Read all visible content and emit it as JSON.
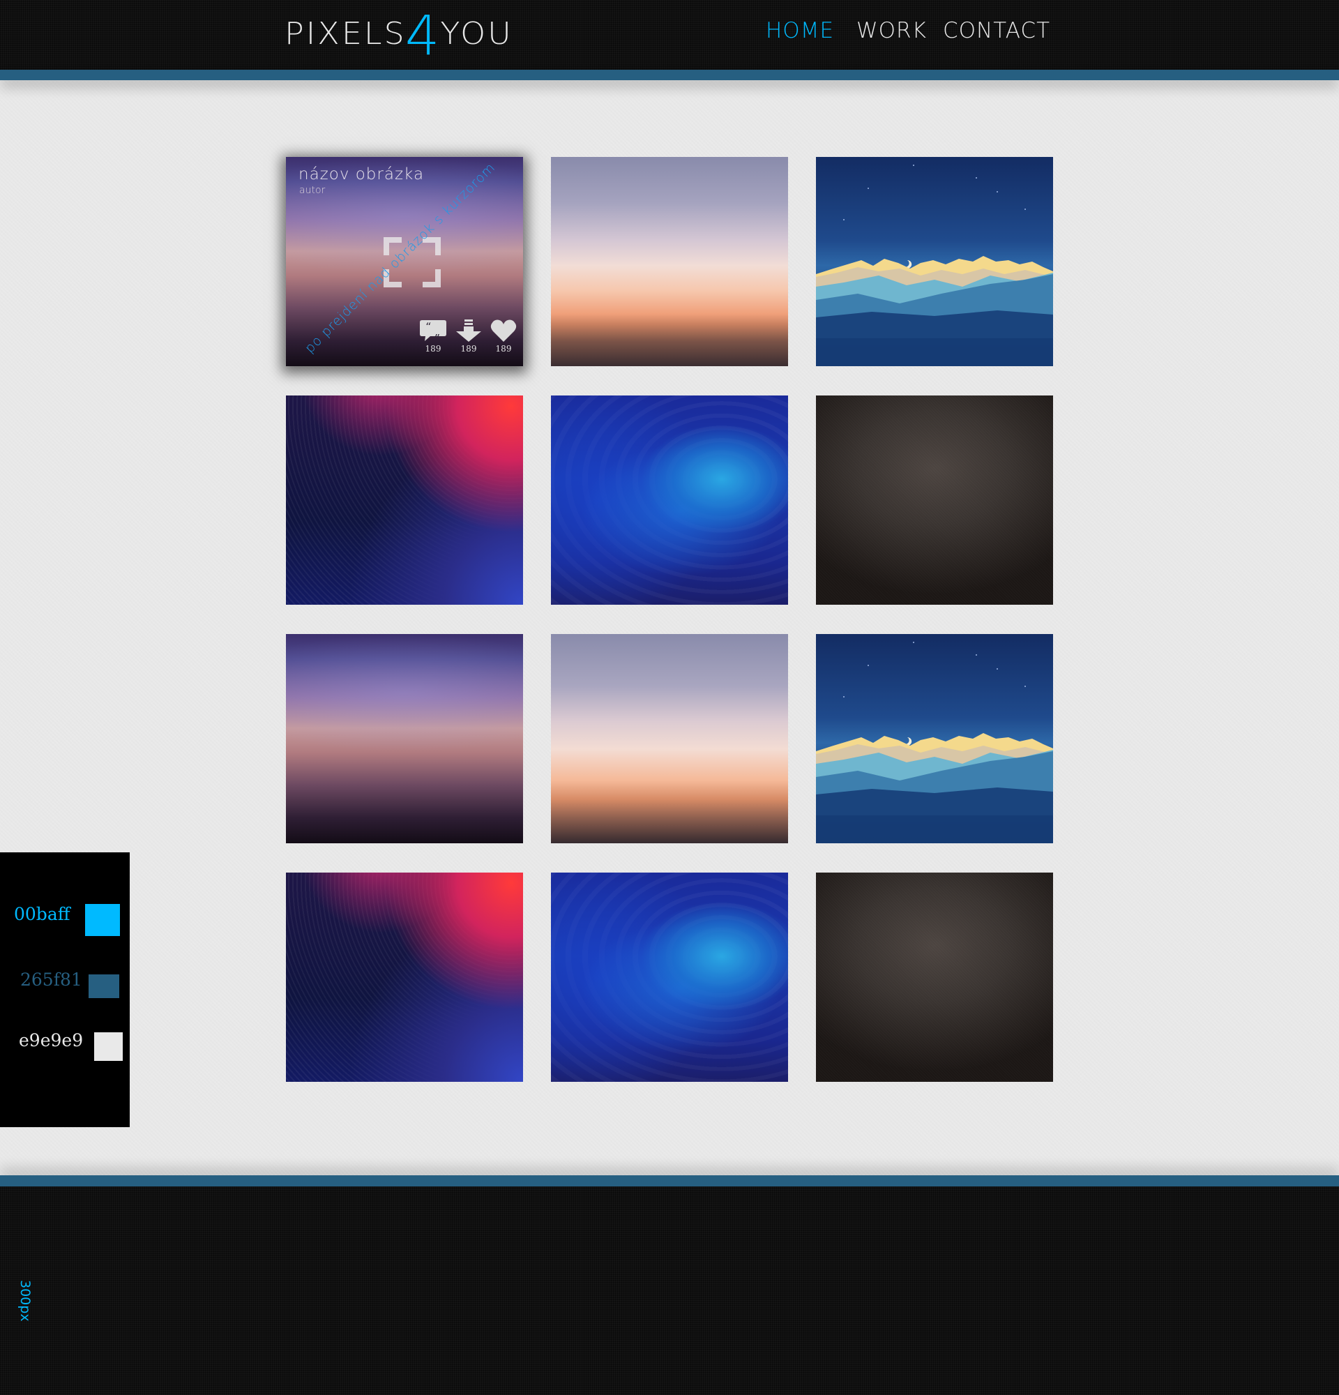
{
  "brand": {
    "logo_left": "PIXELS",
    "logo_digit": "4",
    "logo_right": "YOU",
    "accent_color": "#00baff",
    "stripe_color": "#265f81",
    "background_color": "#e9e9e9"
  },
  "nav": {
    "items": [
      {
        "label": "HOME",
        "active": true
      },
      {
        "label": "WORK",
        "active": false
      },
      {
        "label": "CONTACT",
        "active": false
      }
    ]
  },
  "gallery": {
    "hover_tile": {
      "title": "názov obrázka",
      "author": "autor",
      "hint": "po prejdení nad obrázok s kurzorom",
      "icons": [
        "expand-icon",
        "comment-icon",
        "download-icon",
        "heart-icon"
      ],
      "comments": "189",
      "downloads": "189",
      "likes": "189"
    },
    "tiles": [
      {
        "image": "blurred-dusk-sky",
        "hovered": true
      },
      {
        "image": "sunset-gradient"
      },
      {
        "image": "mountain-night"
      },
      {
        "image": "red-blue-rays"
      },
      {
        "image": "blue-ripples"
      },
      {
        "image": "dark-brown-texture"
      },
      {
        "image": "blurred-dusk-sky"
      },
      {
        "image": "sunset-gradient"
      },
      {
        "image": "mountain-night"
      },
      {
        "image": "red-blue-rays"
      },
      {
        "image": "blue-ripples"
      },
      {
        "image": "dark-brown-texture"
      }
    ]
  },
  "palette": {
    "swatches": [
      {
        "label": "00baff",
        "color": "#00baff"
      },
      {
        "label": "265f81",
        "color": "#265f81"
      },
      {
        "label": "e9e9e9",
        "color": "#e9e9e9"
      }
    ]
  },
  "footer": {
    "height_note": "300px"
  }
}
